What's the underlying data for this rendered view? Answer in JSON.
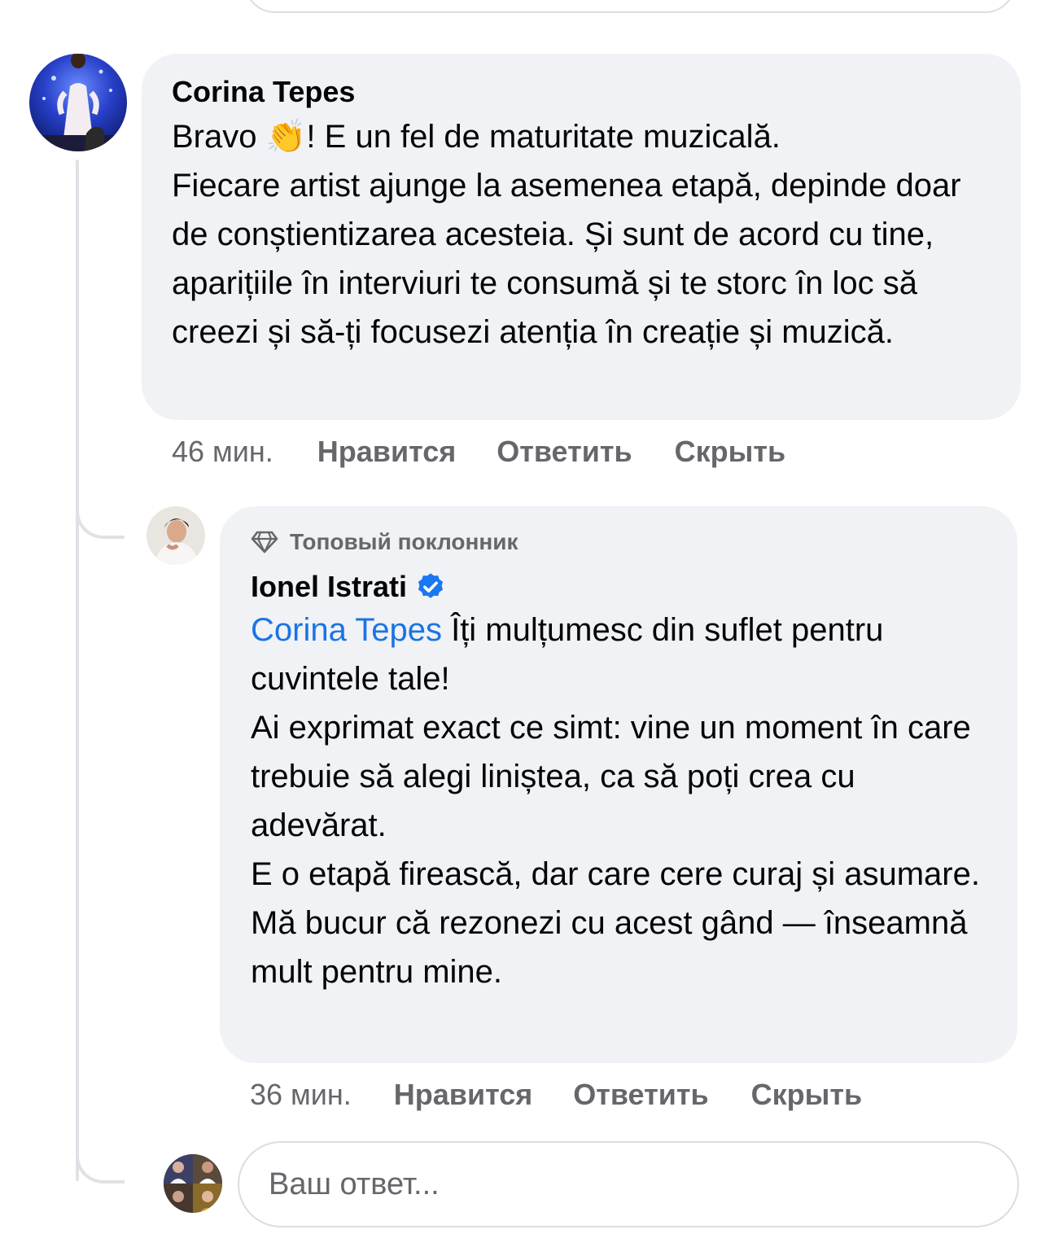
{
  "reply_box_top": {
    "placeholder": ""
  },
  "comment": {
    "author": "Corina Tepes",
    "text_before_emoji": "Bravo ",
    "emoji": "👏",
    "text_after_emoji": "! E un fel de maturitate muzicală.\nFiecare artist ajunge la asemenea etapă, depinde doar de conștientizarea acesteia. Și sunt de acord cu tine, aparițiile în interviuri te consumă și te storc în loc să creezi și să-ți focusezi atenția în creație și muzică.",
    "time": "46 мин.",
    "like_label": "Нравится",
    "reply_label": "Ответить",
    "hide_label": "Скрыть"
  },
  "reply": {
    "badge_icon": "diamond-icon",
    "badge": "Топовый поклонник",
    "author": "Ionel Istrati",
    "verified_icon": "verified-badge-icon",
    "mention": "Corina Tepes",
    "text": " Îți mulțumesc din suflet pentru cuvintele tale!\nAi exprimat exact ce simt: vine un moment în care trebuie să alegi liniștea, ca să poți crea cu adevărat.\nE o etapă firească, dar care cere curaj și asumare.\nMă bucur că rezonezi cu acest gând — înseamnă mult pentru mine.",
    "time": "36 мин.",
    "like_label": "Нравится",
    "reply_label": "Ответить",
    "hide_label": "Скрыть"
  },
  "reply_input": {
    "placeholder": "Ваш ответ..."
  },
  "colors": {
    "bubble": "#f0f2f5",
    "mention": "#1b74e4",
    "secondary_text": "#65676b",
    "verified": "#1877f2"
  }
}
